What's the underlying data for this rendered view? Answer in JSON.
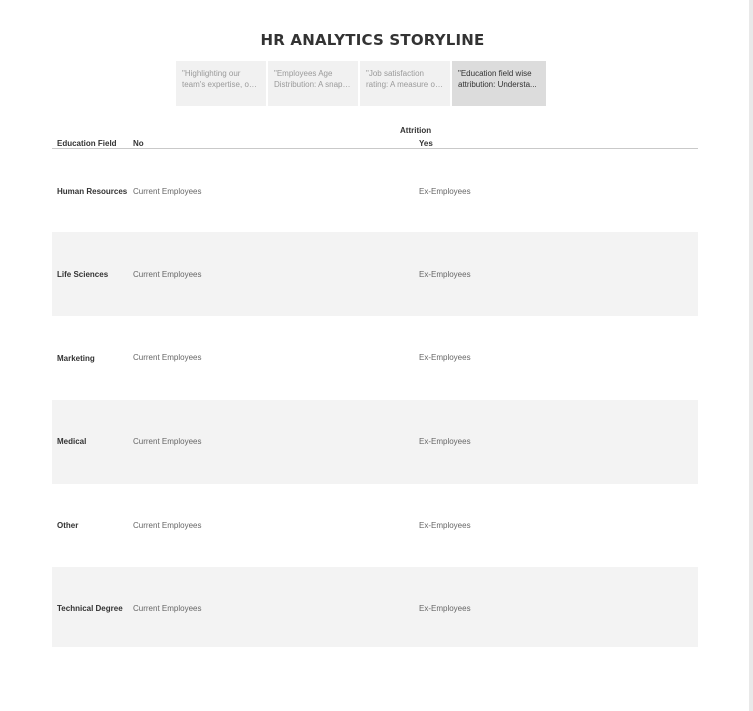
{
  "header": {
    "title": "HR ANALYTICS STORYLINE"
  },
  "story_points": [
    {
      "lines": [
        "\"Highlighting our",
        "team's expertise, one..."
      ],
      "active": false
    },
    {
      "lines": [
        "\"Employees Age",
        "Distribution: A snaps..."
      ],
      "active": false
    },
    {
      "lines": [
        "\"Job satisfaction",
        "rating: A measure of ..."
      ],
      "active": false
    },
    {
      "lines": [
        "\"Education field wise",
        "attribution: Understa..."
      ],
      "active": true
    }
  ],
  "table": {
    "group_header": "Attrition",
    "row_header": "Education Field",
    "columns": [
      "No",
      "Yes"
    ],
    "rows": [
      {
        "field": "Human Resources",
        "no": "Current Employees",
        "yes": "Ex-Employees"
      },
      {
        "field": "Life Sciences",
        "no": "Current Employees",
        "yes": "Ex-Employees"
      },
      {
        "field": "Marketing",
        "no": "Current Employees",
        "yes": "Ex-Employees"
      },
      {
        "field": "Medical",
        "no": "Current Employees",
        "yes": "Ex-Employees"
      },
      {
        "field": "Other",
        "no": "Current Employees",
        "yes": "Ex-Employees"
      },
      {
        "field": "Technical Degree",
        "no": "Current Employees",
        "yes": "Ex-Employees"
      }
    ]
  }
}
